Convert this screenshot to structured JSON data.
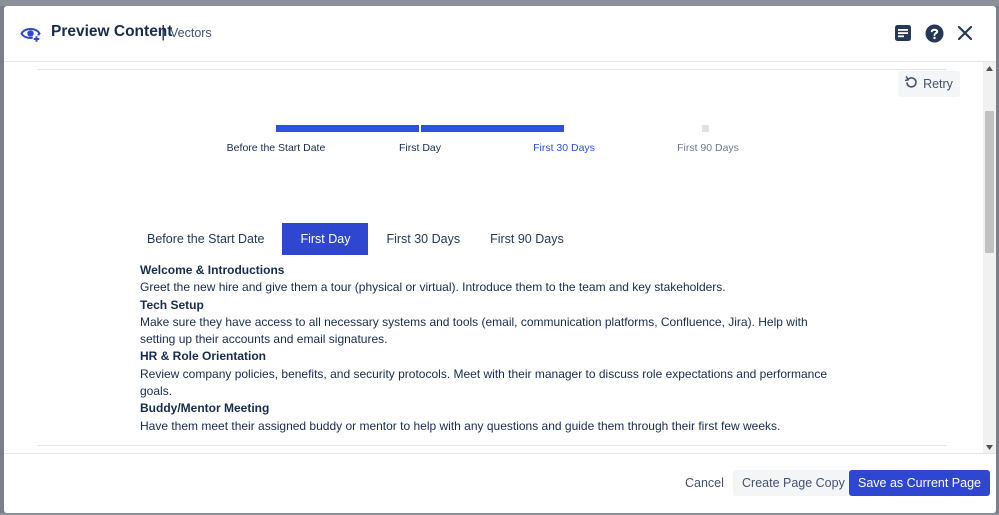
{
  "header": {
    "title": "Preview Content",
    "separator": "|",
    "subtitle": "Vectors",
    "icons": [
      "preview-eye-icon",
      "notes-icon",
      "help-icon",
      "close-icon"
    ]
  },
  "retry": {
    "label": "Retry"
  },
  "progress": {
    "steps": [
      {
        "label": "Before the Start Date",
        "state": "done"
      },
      {
        "label": "First Day",
        "state": "done"
      },
      {
        "label": "First 30 Days",
        "state": "current"
      },
      {
        "label": "First 90 Days",
        "state": "pending"
      }
    ]
  },
  "tabs": [
    {
      "label": "Before the Start Date",
      "active": false
    },
    {
      "label": "First Day",
      "active": true
    },
    {
      "label": "First 30 Days",
      "active": false
    },
    {
      "label": "First 90 Days",
      "active": false
    }
  ],
  "sections": [
    {
      "heading": "Welcome & Introductions",
      "body": "Greet the new hire and give them a tour (physical or virtual). Introduce them to the team and key stakeholders."
    },
    {
      "heading": "Tech Setup",
      "body": "Make sure they have access to all necessary systems and tools (email, communication platforms, Confluence, Jira). Help with setting up their accounts and email signatures."
    },
    {
      "heading": "HR & Role Orientation",
      "body": "Review company policies, benefits, and security protocols. Meet with their manager to discuss role expectations and performance goals."
    },
    {
      "heading": "Buddy/Mentor Meeting",
      "body": "Have them meet their assigned buddy or mentor to help with any questions and guide them through their first few weeks."
    }
  ],
  "footer": {
    "cancel_label": "Cancel",
    "copy_label": "Create Page Copy",
    "save_label": "Save as Current Page"
  },
  "colors": {
    "accent": "#2f47d0",
    "progress": "#2f4fe0",
    "text": "#172b4d"
  }
}
